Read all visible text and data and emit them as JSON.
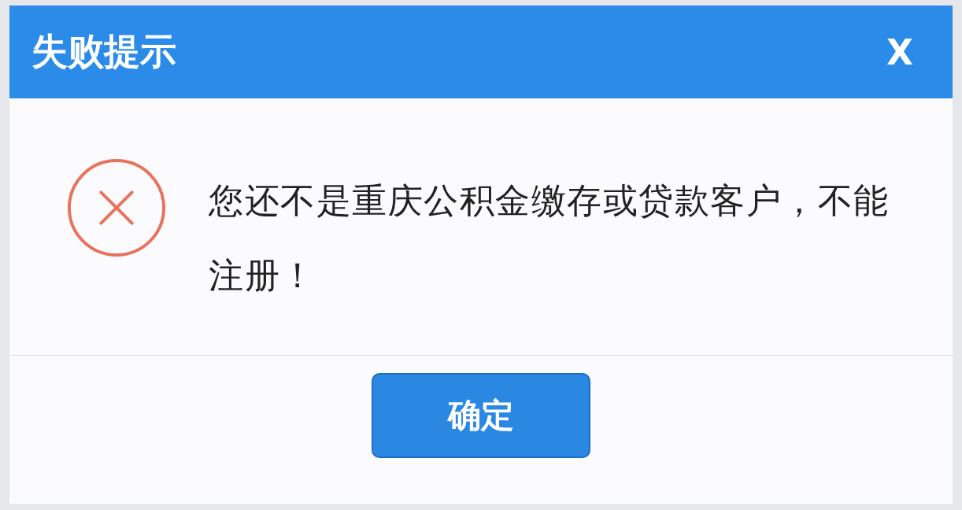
{
  "dialog": {
    "title": "失败提示",
    "close": "X",
    "kind": "error",
    "message": "您还不是重庆公积金缴存或贷款客户，不能注册！",
    "buttons": [
      "确定"
    ]
  }
}
